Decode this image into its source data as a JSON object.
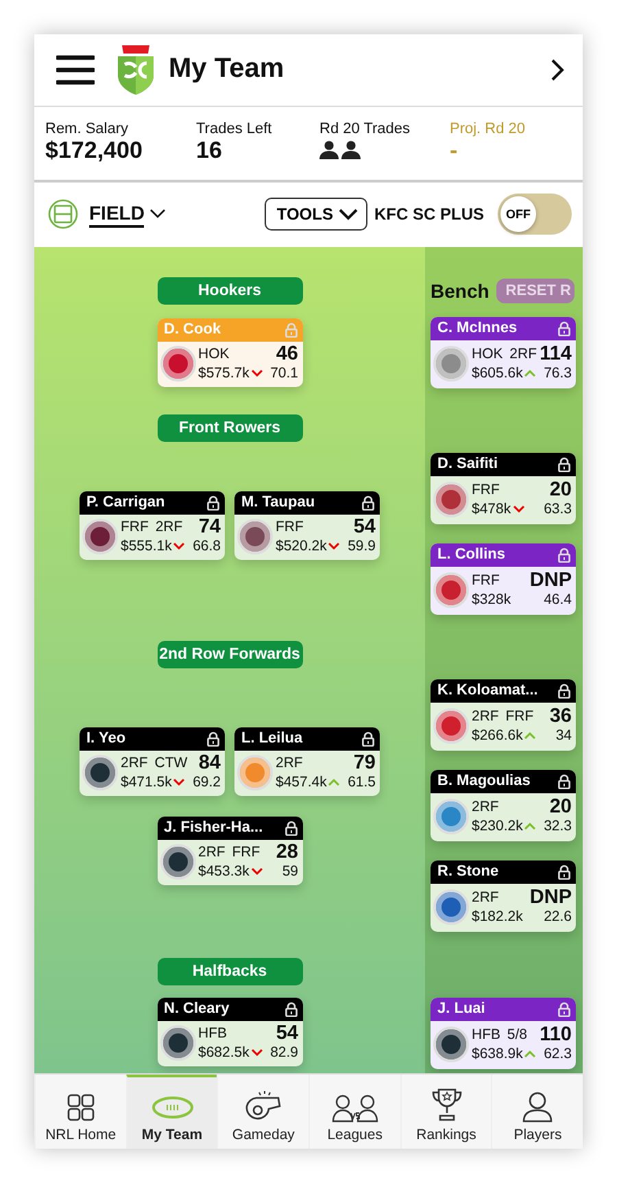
{
  "header": {
    "title": "My Team"
  },
  "stats": [
    {
      "kind": "plain",
      "label": "Rem. Salary",
      "value": "$172,400"
    },
    {
      "kind": "plain",
      "label": "Trades Left",
      "value": "16"
    },
    {
      "kind": "icons",
      "label": "Rd 20 Trades"
    },
    {
      "kind": "projection",
      "label": "Proj. Rd 20",
      "value": "-"
    }
  ],
  "toolbar": {
    "view": "FIELD",
    "tools": "TOOLS",
    "plus_label": "KFC SC PLUS",
    "toggle": {
      "label": "OFF",
      "on": false
    }
  },
  "sections": [
    {
      "title": "Hookers",
      "rows": [
        [
          {
            "name": "D. Cook",
            "kind": "captain",
            "color": "#c8102e",
            "positions": "HOK",
            "price": "$575.7k",
            "up": false,
            "score": "46",
            "average": "70.1"
          }
        ]
      ]
    },
    {
      "title": "Front Rowers",
      "rows": [
        [
          {
            "name": "P. Carrigan",
            "kind": "starter",
            "color": "#6d1f3a",
            "positions": "FRF 2RF",
            "price": "$555.1k",
            "up": false,
            "score": "74",
            "average": "66.8"
          },
          {
            "name": "M. Taupau",
            "kind": "starter",
            "color": "#7a4a58",
            "positions": "FRF",
            "price": "$520.2k",
            "up": false,
            "score": "54",
            "average": "59.9"
          }
        ]
      ]
    },
    {
      "title": "2nd Row Forwards",
      "rows": [
        [
          {
            "name": "I. Yeo",
            "kind": "starter",
            "color": "#1f2f38",
            "positions": "2RF CTW",
            "price": "$471.5k",
            "up": false,
            "score": "84",
            "average": "69.2"
          },
          {
            "name": "L. Leilua",
            "kind": "starter",
            "color": "#f08a2c",
            "positions": "2RF",
            "price": "$457.4k",
            "up": true,
            "score": "79",
            "average": "61.5"
          }
        ],
        [
          {
            "name": "J. Fisher-Ha...",
            "kind": "starter",
            "color": "#1f2f38",
            "positions": "2RF FRF",
            "price": "$453.3k",
            "up": false,
            "score": "28",
            "average": "59"
          }
        ]
      ]
    },
    {
      "title": "Halfbacks",
      "rows": [
        [
          {
            "name": "N. Cleary",
            "kind": "starter",
            "color": "#1f2f38",
            "positions": "HFB",
            "price": "$682.5k",
            "up": false,
            "score": "54",
            "average": "82.9"
          }
        ]
      ]
    }
  ],
  "bench": {
    "title": "Bench",
    "reset": "RESET R",
    "players": [
      {
        "name": "C. McInnes",
        "kind": "emergency",
        "color": "#8c8c8c",
        "positions": "HOK 2RF",
        "price": "$605.6k",
        "up": true,
        "score": "114",
        "average": "76.3"
      },
      {
        "name": "D. Saifiti",
        "kind": "starter",
        "color": "#b0303a",
        "positions": "FRF",
        "price": "$478k",
        "up": false,
        "score": "20",
        "average": "63.3"
      },
      {
        "name": "L. Collins",
        "kind": "emergency",
        "color": "#c8202e",
        "positions": "FRF",
        "price": "$328k",
        "score": "DNP",
        "average": "46.4"
      },
      {
        "name": "K. Koloamat...",
        "kind": "starter",
        "color": "#d0202e",
        "positions": "2RF FRF",
        "price": "$266.6k",
        "up": true,
        "score": "36",
        "average": "34"
      },
      {
        "name": "B. Magoulias",
        "kind": "starter",
        "color": "#2a86c5",
        "positions": "2RF",
        "price": "$230.2k",
        "up": true,
        "score": "20",
        "average": "32.3"
      },
      {
        "name": "R. Stone",
        "kind": "starter",
        "color": "#1e5fb5",
        "positions": "2RF",
        "price": "$182.2k",
        "score": "DNP",
        "average": "22.6"
      },
      {
        "name": "J. Luai",
        "kind": "emergency",
        "color": "#1f2f38",
        "positions": "HFB 5/8",
        "price": "$638.9k",
        "up": true,
        "score": "110",
        "average": "62.3"
      }
    ]
  },
  "nav": [
    {
      "kind": "home",
      "label": "NRL Home",
      "selected": false
    },
    {
      "kind": "team",
      "label": "My Team",
      "selected": true
    },
    {
      "kind": "gameday",
      "label": "Gameday",
      "selected": false
    },
    {
      "kind": "leagues",
      "label": "Leagues",
      "selected": false
    },
    {
      "kind": "rankings",
      "label": "Rankings",
      "selected": false
    },
    {
      "kind": "players",
      "label": "Players",
      "selected": false
    }
  ]
}
